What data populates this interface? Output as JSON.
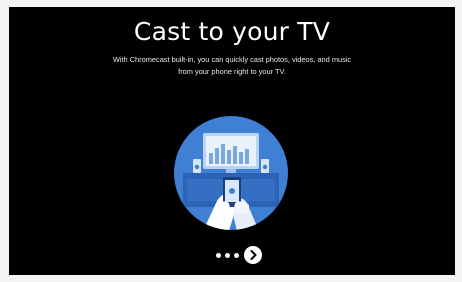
{
  "setup_screen": {
    "title": "Cast to your TV",
    "description_line1": "With Chromecast built-in, you can quickly cast photos, videos, and music",
    "description_line2": "from your phone right to your TV."
  },
  "pager": {
    "dot_count": 3,
    "next_icon": "chevron-right-icon"
  },
  "colors": {
    "screen_background": "#000000",
    "illustration_circle": "#3f7fd4",
    "illustration_dark": "#1f4f9e",
    "illustration_light": "#a8c8f0",
    "text": "#ffffff"
  }
}
